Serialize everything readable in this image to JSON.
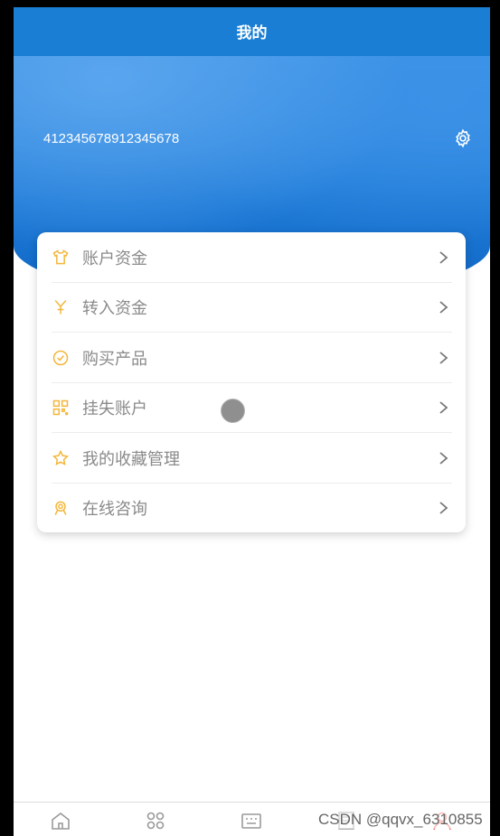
{
  "header": {
    "title": "我的"
  },
  "profile": {
    "account_id": "412345678912345678"
  },
  "menu": [
    {
      "label": "账户资金",
      "icon": "shirt-icon"
    },
    {
      "label": "转入资金",
      "icon": "transfer-in-icon"
    },
    {
      "label": "购买产品",
      "icon": "clock-check-icon"
    },
    {
      "label": "挂失账户",
      "icon": "grid-qr-icon"
    },
    {
      "label": "我的收藏管理",
      "icon": "star-icon"
    },
    {
      "label": "在线咨询",
      "icon": "support-agent-icon"
    }
  ],
  "tabbar": {
    "items": [
      "home-icon",
      "apps-icon",
      "keyboard-icon",
      "document-icon",
      "person-icon"
    ]
  },
  "watermark": "CSDN @qqvx_6310855",
  "colors": {
    "primary": "#1a7fd4",
    "icon_accent": "#f4b63a",
    "active_tab": "#e8594f"
  }
}
